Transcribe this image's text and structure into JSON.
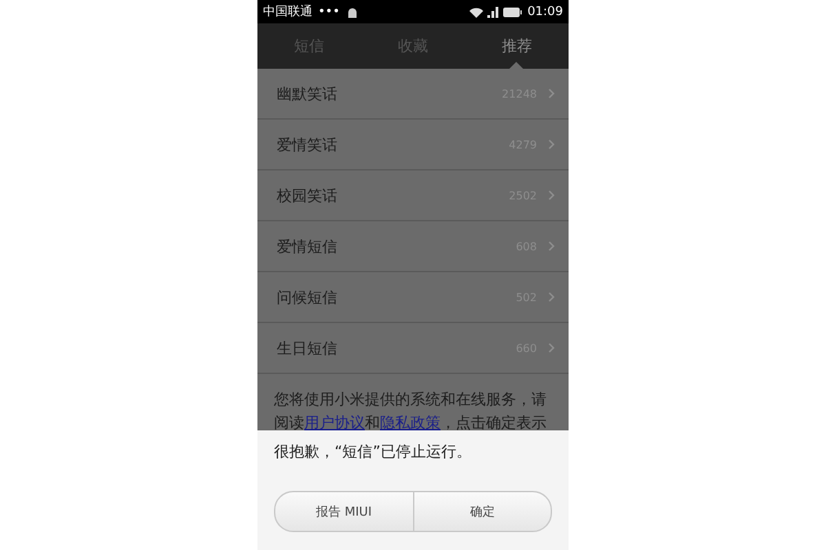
{
  "status_bar": {
    "carrier": "中国联通",
    "dots": "•••",
    "time": "01:09"
  },
  "tabs": [
    {
      "label": "短信",
      "selected": false
    },
    {
      "label": "收藏",
      "selected": false
    },
    {
      "label": "推荐",
      "selected": true
    }
  ],
  "categories": [
    {
      "name": "幽默笑话",
      "count": "21248"
    },
    {
      "name": "爱情笑话",
      "count": "4279"
    },
    {
      "name": "校园笑话",
      "count": "2502"
    },
    {
      "name": "爱情短信",
      "count": "608"
    },
    {
      "name": "问候短信",
      "count": "502"
    },
    {
      "name": "生日短信",
      "count": "660"
    }
  ],
  "notice": [
    {
      "kind": "text",
      "text": "您将使用小米提供的系统和在线服务，请阅读"
    },
    {
      "kind": "link",
      "text": "用户协议"
    },
    {
      "kind": "text",
      "text": "和"
    },
    {
      "kind": "link",
      "text": "隐私政策"
    },
    {
      "kind": "text",
      "text": "，点击确定表示"
    }
  ],
  "dialog": {
    "message": "很抱歉，“短信”已停止运行。",
    "buttons": [
      "报告 MIUI",
      "确定"
    ]
  }
}
